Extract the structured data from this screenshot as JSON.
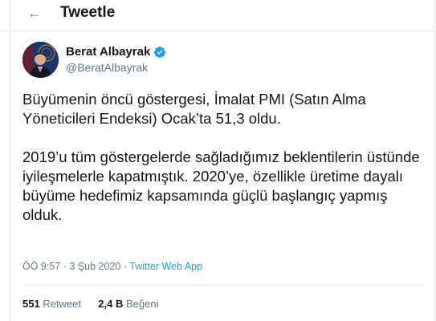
{
  "header": {
    "back_icon": "arrow-left-icon",
    "title": "Tweetle"
  },
  "tweet": {
    "author_name": "Berat Albayrak",
    "author_handle": "@BeratAlbayrak",
    "paragraphs": [
      "Büyümenin öncü göstergesi, İmalat PMI (Satın Alma Yöneticileri Endeksi) Ocak’ta 51,3 oldu.",
      "2019’u tüm göstergelerde sağladığımız beklentilerin üstünde iyileşmelerle kapatmıştık. 2020’ye, özellikle üretime dayalı büyüme hedefimiz kapsamında güçlü başlangıç yapmış olduk."
    ],
    "time": "ÖÖ 9:57",
    "date": "3 Şub 2020",
    "separator": "·",
    "app": "Twitter Web App",
    "retweets": {
      "count": "551",
      "label": "Retweet"
    },
    "likes": {
      "count": "2,4 B",
      "label": "Beğeni"
    }
  },
  "colors": {
    "accent": "#1da1f2",
    "text": "#14171a",
    "muted": "#657786",
    "border": "#e6ecf0"
  }
}
